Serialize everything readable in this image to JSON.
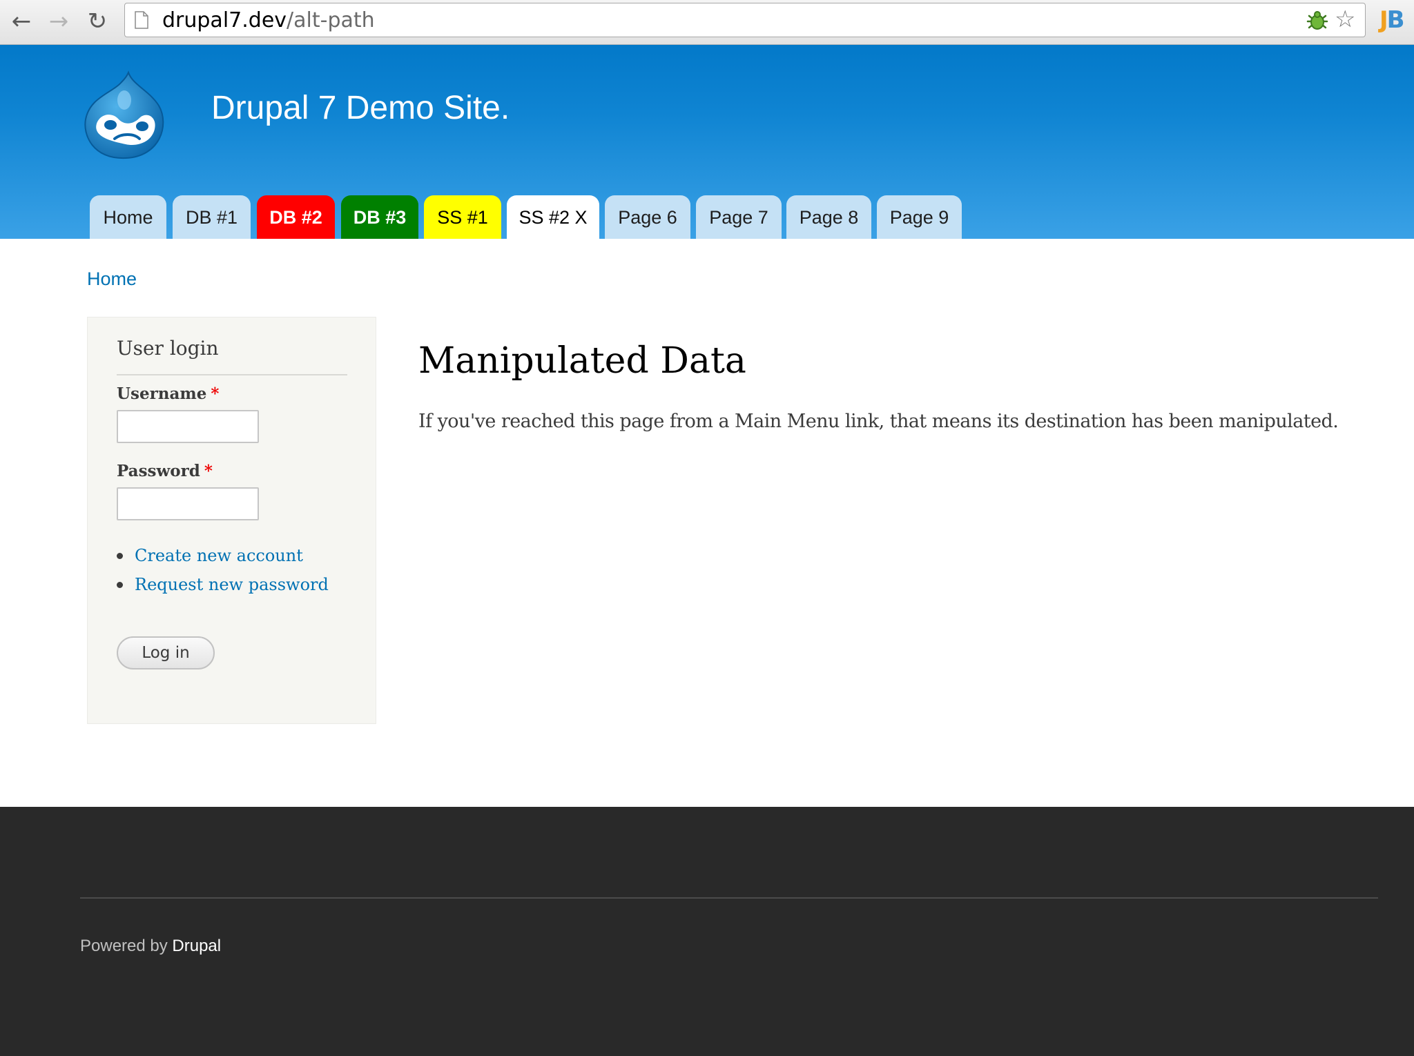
{
  "browser": {
    "url_host": "drupal7.dev",
    "url_path": "/alt-path",
    "icons": {
      "back": "back-arrow-icon",
      "forward": "forward-arrow-icon",
      "reload": "reload-icon",
      "page": "page-icon",
      "extension": "bug-icon",
      "bookmark": "star-icon",
      "jb": "jb-extension-icon"
    },
    "jb_letters": [
      "J",
      "B"
    ]
  },
  "site": {
    "name": "Drupal 7 Demo Site.",
    "logo_icon": "drupal-drop-logo",
    "header_color": "#0f84d2"
  },
  "main_menu": [
    {
      "label": "Home",
      "style": "default"
    },
    {
      "label": "DB #1",
      "style": "default"
    },
    {
      "label": "DB #2",
      "style": "red"
    },
    {
      "label": "DB #3",
      "style": "green"
    },
    {
      "label": "SS #1",
      "style": "yellow"
    },
    {
      "label": "SS #2 X",
      "style": "active"
    },
    {
      "label": "Page 6",
      "style": "default"
    },
    {
      "label": "Page 7",
      "style": "default"
    },
    {
      "label": "Page 8",
      "style": "default"
    },
    {
      "label": "Page 9",
      "style": "default"
    }
  ],
  "breadcrumb": {
    "home": "Home"
  },
  "user_login": {
    "title": "User login",
    "username_label": "Username",
    "password_label": "Password",
    "required_mark": "*",
    "username_value": "",
    "password_value": "",
    "links": [
      "Create new account",
      "Request new password"
    ],
    "submit_label": "Log in"
  },
  "content": {
    "title": "Manipulated Data",
    "body": "If you've reached this page from a Main Menu link, that means its destination has been manipulated."
  },
  "footer": {
    "powered_by": "Powered by ",
    "drupal_link": "Drupal"
  },
  "colors": {
    "link": "#0071b3",
    "tab_default": "#c5e1f5",
    "tab_red": "#ff0000",
    "tab_green": "#008000",
    "tab_yellow": "#ffff00",
    "footer_bg": "#292929"
  }
}
